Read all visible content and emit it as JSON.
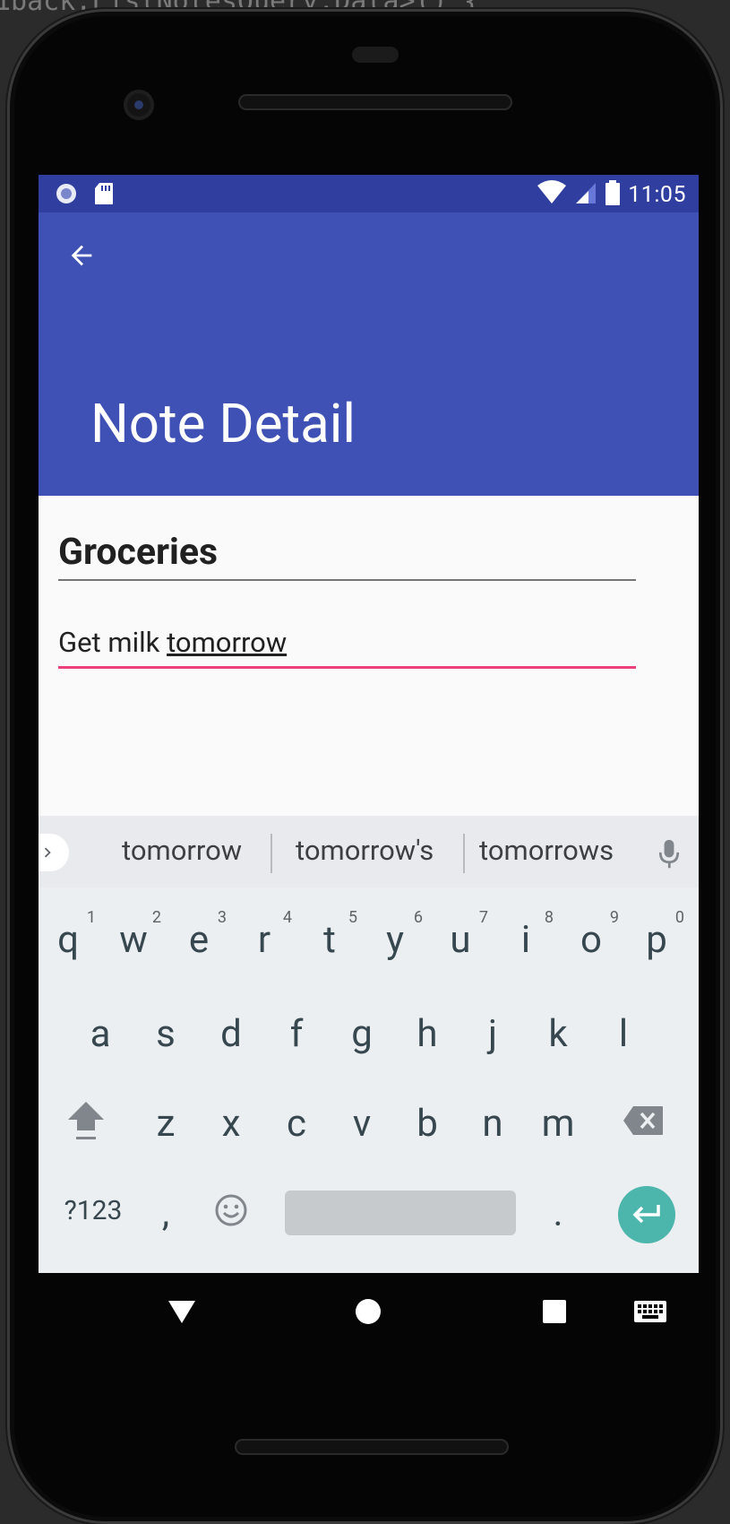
{
  "status": {
    "time": "11:05"
  },
  "appbar": {
    "title": "Note Detail"
  },
  "note": {
    "title": "Groceries",
    "body_prefix": "Get milk ",
    "body_composing": "tomorrow"
  },
  "keyboard": {
    "suggestions": [
      "tomorrow",
      "tomorrow's",
      "tomorrows"
    ],
    "row1": [
      {
        "k": "q",
        "h": "1"
      },
      {
        "k": "w",
        "h": "2"
      },
      {
        "k": "e",
        "h": "3"
      },
      {
        "k": "r",
        "h": "4"
      },
      {
        "k": "t",
        "h": "5"
      },
      {
        "k": "y",
        "h": "6"
      },
      {
        "k": "u",
        "h": "7"
      },
      {
        "k": "i",
        "h": "8"
      },
      {
        "k": "o",
        "h": "9"
      },
      {
        "k": "p",
        "h": "0"
      }
    ],
    "row2": [
      "a",
      "s",
      "d",
      "f",
      "g",
      "h",
      "j",
      "k",
      "l"
    ],
    "row3": [
      "z",
      "x",
      "c",
      "v",
      "b",
      "n",
      "m"
    ],
    "symbols_label": "?123",
    "comma_label": ",",
    "period_label": "."
  },
  "colors": {
    "status_bar": "#303f9f",
    "app_bar": "#3f51b5",
    "accent": "#ec407a",
    "enter_key": "#4db6ac"
  }
}
